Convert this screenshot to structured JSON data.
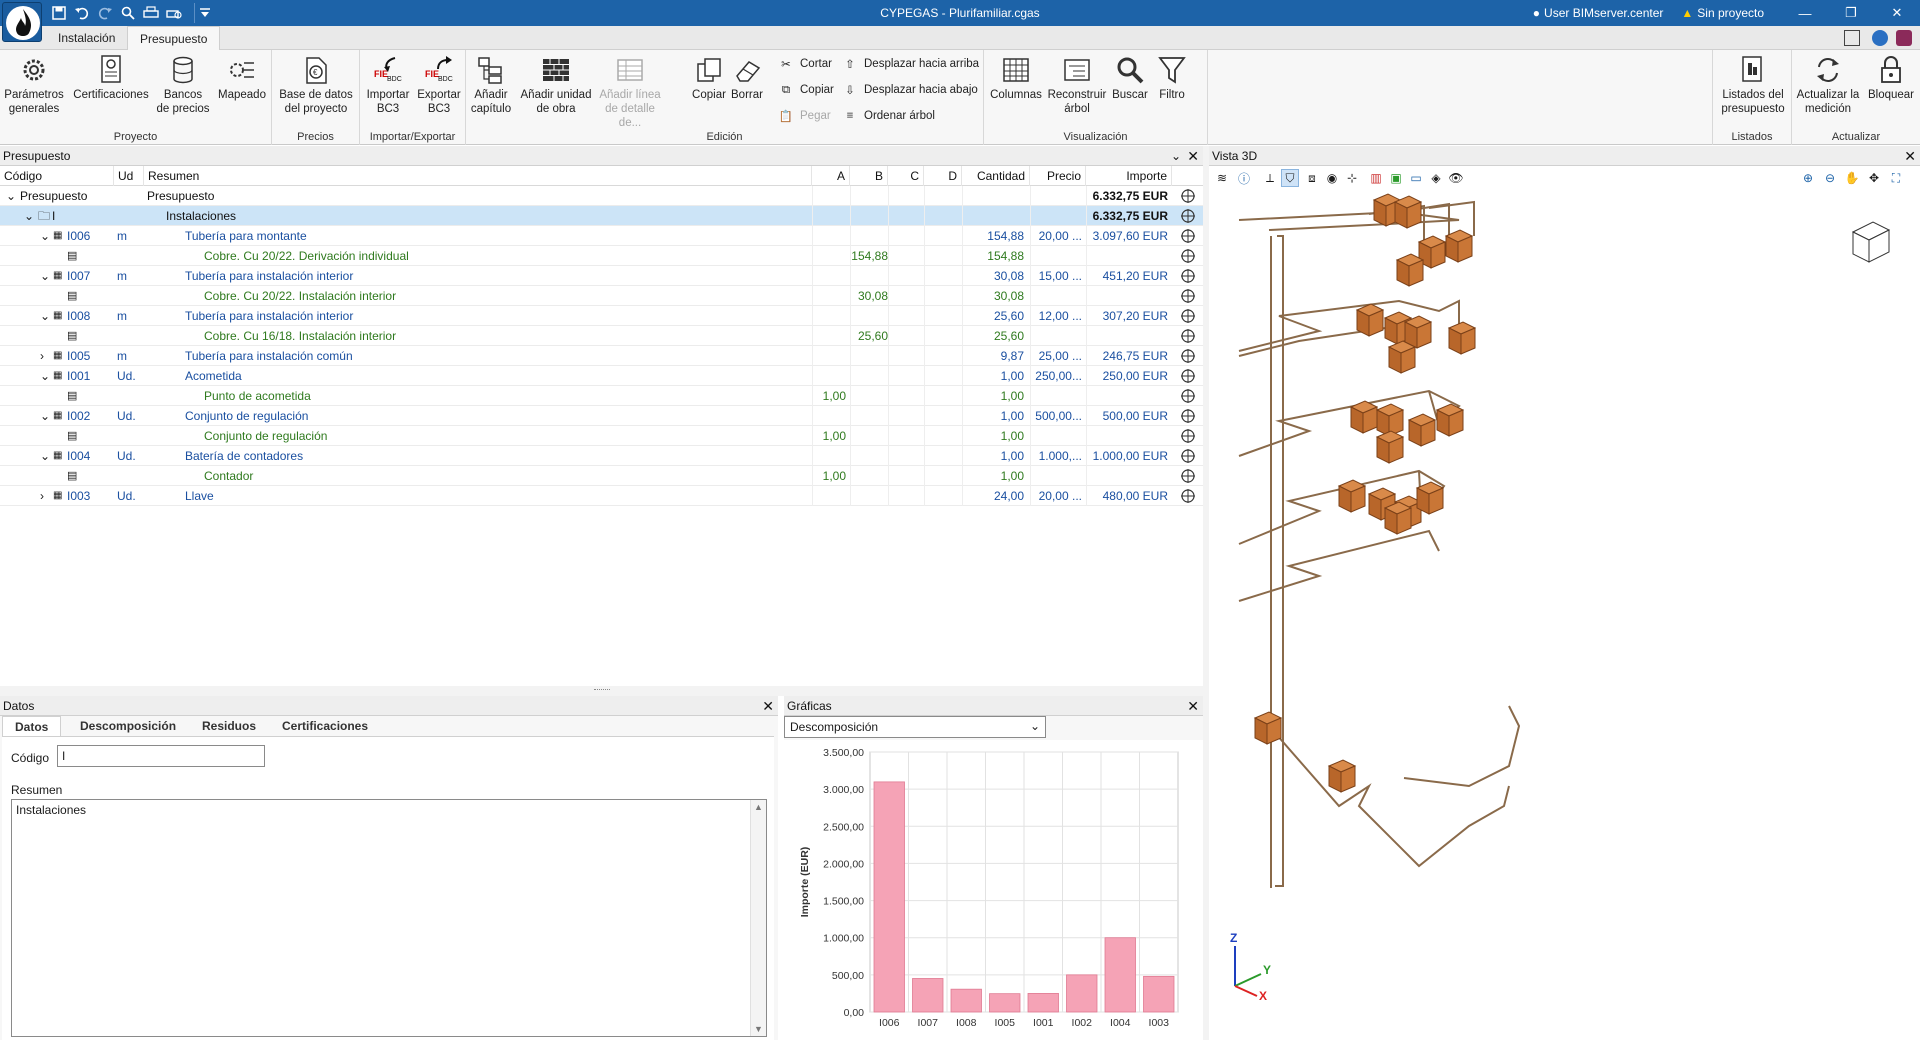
{
  "app": {
    "title": "CYPEGAS - Plurifamiliar.cgas",
    "user": "User BIMserver.center",
    "project": "Sin proyecto"
  },
  "tabs": [
    {
      "label": "Instalación"
    },
    {
      "label": "Presupuesto"
    }
  ],
  "ribbon": {
    "groups": {
      "proyecto": "Proyecto",
      "precios": "Precios",
      "impexp": "Importar/Exportar",
      "edicion": "Edición",
      "visualizacion": "Visualización",
      "listados": "Listados",
      "actualizar": "Actualizar"
    },
    "parametros": "Parámetros generales",
    "certificaciones": "Certificaciones",
    "bancos": "Bancos de precios",
    "mapeado": "Mapeado",
    "basedatos": "Base de datos del proyecto",
    "importar": "Importar BC3",
    "exportar": "Exportar BC3",
    "anadir_capitulo": "Añadir capítulo",
    "anadir_unidad": "Añadir unidad de obra",
    "anadir_linea": "Añadir línea de detalle de...",
    "copiar": "Copiar",
    "borrar": "Borrar",
    "cortar": "Cortar",
    "copiar_s": "Copiar",
    "pegar": "Pegar",
    "desplazar_arriba": "Desplazar hacia arriba",
    "desplazar_abajo": "Desplazar hacia abajo",
    "ordenar": "Ordenar árbol",
    "columnas": "Columnas",
    "reconstruir": "Reconstruir árbol",
    "buscar": "Buscar",
    "filtro": "Filtro",
    "listados": "Listados del presupuesto",
    "actualizar_med": "Actualizar la medición",
    "bloquear": "Bloquear"
  },
  "budget": {
    "title": "Presupuesto",
    "columns": {
      "codigo": "Código",
      "ud": "Ud",
      "resumen": "Resumen",
      "a": "A",
      "b": "B",
      "c": "C",
      "d": "D",
      "cantidad": "Cantidad",
      "precio": "Precio",
      "importe": "Importe"
    },
    "rows": [
      {
        "codigo": "Presupuesto",
        "ud": "",
        "resumen": "Presupuesto",
        "a": "",
        "b": "",
        "cantidad": "",
        "precio": "",
        "importe": "6.332,75 EUR"
      },
      {
        "codigo": "I",
        "ud": "",
        "resumen": "Instalaciones",
        "a": "",
        "b": "",
        "cantidad": "",
        "precio": "",
        "importe": "6.332,75 EUR"
      },
      {
        "codigo": "I006",
        "ud": "m",
        "resumen": "Tubería para montante",
        "a": "",
        "b": "",
        "cantidad": "154,88",
        "precio": "20,00 ...",
        "importe": "3.097,60 EUR"
      },
      {
        "codigo": "",
        "ud": "",
        "resumen": "Cobre. Cu 20/22. Derivación individual",
        "a": "",
        "b": "154,88",
        "cantidad": "154,88",
        "precio": "",
        "importe": ""
      },
      {
        "codigo": "I007",
        "ud": "m",
        "resumen": "Tubería para instalación interior",
        "a": "",
        "b": "",
        "cantidad": "30,08",
        "precio": "15,00 ...",
        "importe": "451,20 EUR"
      },
      {
        "codigo": "",
        "ud": "",
        "resumen": "Cobre. Cu 20/22. Instalación interior",
        "a": "",
        "b": "30,08",
        "cantidad": "30,08",
        "precio": "",
        "importe": ""
      },
      {
        "codigo": "I008",
        "ud": "m",
        "resumen": "Tubería para instalación interior",
        "a": "",
        "b": "",
        "cantidad": "25,60",
        "precio": "12,00 ...",
        "importe": "307,20 EUR"
      },
      {
        "codigo": "",
        "ud": "",
        "resumen": "Cobre. Cu 16/18. Instalación interior",
        "a": "",
        "b": "25,60",
        "cantidad": "25,60",
        "precio": "",
        "importe": ""
      },
      {
        "codigo": "I005",
        "ud": "m",
        "resumen": "Tubería para instalación común",
        "a": "",
        "b": "",
        "cantidad": "9,87",
        "precio": "25,00 ...",
        "importe": "246,75 EUR"
      },
      {
        "codigo": "I001",
        "ud": "Ud.",
        "resumen": "Acometida",
        "a": "",
        "b": "",
        "cantidad": "1,00",
        "precio": "250,00...",
        "importe": "250,00 EUR"
      },
      {
        "codigo": "",
        "ud": "",
        "resumen": "Punto de acometida",
        "a": "1,00",
        "b": "",
        "cantidad": "1,00",
        "precio": "",
        "importe": ""
      },
      {
        "codigo": "I002",
        "ud": "Ud.",
        "resumen": "Conjunto de regulación",
        "a": "",
        "b": "",
        "cantidad": "1,00",
        "precio": "500,00...",
        "importe": "500,00 EUR"
      },
      {
        "codigo": "",
        "ud": "",
        "resumen": "Conjunto de regulación",
        "a": "1,00",
        "b": "",
        "cantidad": "1,00",
        "precio": "",
        "importe": ""
      },
      {
        "codigo": "I004",
        "ud": "Ud.",
        "resumen": "Batería de contadores",
        "a": "",
        "b": "",
        "cantidad": "1,00",
        "precio": "1.000,...",
        "importe": "1.000,00 EUR"
      },
      {
        "codigo": "",
        "ud": "",
        "resumen": "Contador",
        "a": "1,00",
        "b": "",
        "cantidad": "1,00",
        "precio": "",
        "importe": ""
      },
      {
        "codigo": "I003",
        "ud": "Ud.",
        "resumen": "Llave",
        "a": "",
        "b": "",
        "cantidad": "24,00",
        "precio": "20,00 ...",
        "importe": "480,00 EUR"
      }
    ]
  },
  "datos": {
    "title": "Datos",
    "tabs": [
      "Datos",
      "Descomposición",
      "Residuos",
      "Certificaciones"
    ],
    "codigo_label": "Código",
    "codigo_value": "I",
    "resumen_label": "Resumen",
    "resumen_value": "Instalaciones"
  },
  "graficas": {
    "title": "Gráficas",
    "select": "Descomposición"
  },
  "chart_data": {
    "type": "bar",
    "categories": [
      "I006",
      "I007",
      "I008",
      "I005",
      "I001",
      "I002",
      "I004",
      "I003"
    ],
    "values": [
      3097.6,
      451.2,
      307.2,
      246.75,
      250.0,
      500.0,
      1000.0,
      480.0
    ],
    "ylabel": "Importe (EUR)",
    "ylim": [
      0,
      3500
    ],
    "yticks": [
      "0,00",
      "500,00",
      "1.000,00",
      "1.500,00",
      "2.000,00",
      "2.500,00",
      "3.000,00",
      "3.500,00"
    ],
    "bar_color": "#f5a3b6",
    "grid": true
  },
  "view3d": {
    "title": "Vista 3D"
  }
}
